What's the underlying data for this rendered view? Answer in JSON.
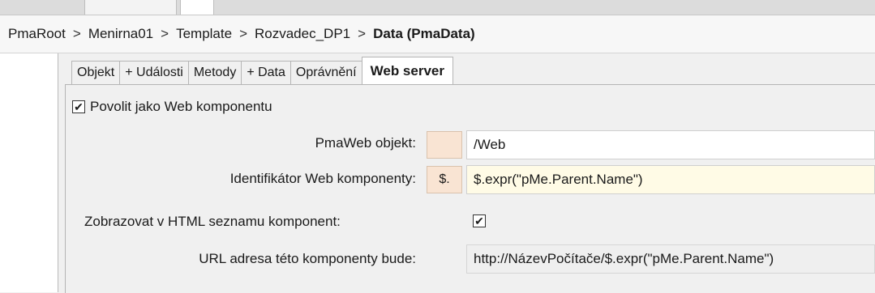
{
  "breadcrumb": {
    "items": [
      "PmaRoot",
      "Menirna01",
      "Template",
      "Rozvadec_DP1"
    ],
    "separator": ">",
    "current": "Data (PmaData)"
  },
  "tabs": [
    {
      "label": "Objekt",
      "active": false
    },
    {
      "label": "+ Události",
      "active": false
    },
    {
      "label": "Metody",
      "active": false
    },
    {
      "label": "+ Data",
      "active": false
    },
    {
      "label": "Oprávnění",
      "active": false
    },
    {
      "label": "Web server",
      "active": true
    }
  ],
  "web_server": {
    "enable_label": "Povolit jako Web komponentu",
    "enable_checked": true,
    "check_mark": "✔",
    "pmaweb_label": "PmaWeb objekt:",
    "pmaweb_button": "",
    "pmaweb_value": "/Web",
    "identifier_label": "Identifikátor Web komponenty:",
    "identifier_button": "$.",
    "identifier_value": "$.expr(\"pMe.Parent.Name\")",
    "show_in_list_label": "Zobrazovat v HTML seznamu komponent:",
    "show_in_list_checked": true,
    "url_label": "URL adresa této komponenty bude:",
    "url_value": "http://NázevPočítače/$.expr(\"pMe.Parent.Name\")"
  },
  "colors": {
    "button_peach": "#f9e4d3",
    "expr_background": "#fffbe6",
    "readonly_background": "#efefef"
  }
}
